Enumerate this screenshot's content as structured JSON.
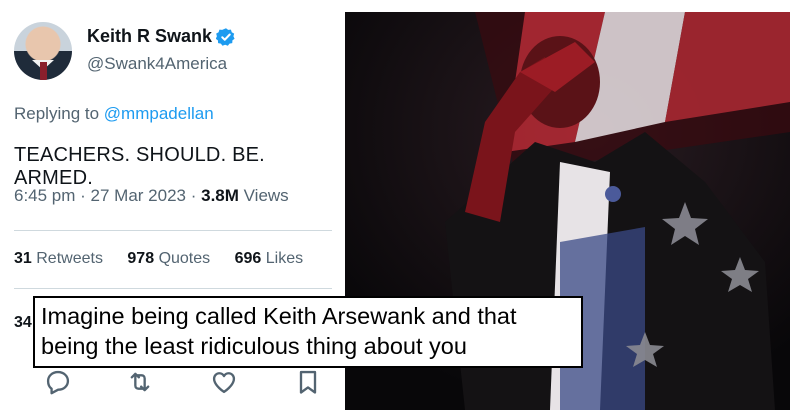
{
  "tweet": {
    "author_name": "Keith R Swank",
    "handle": "@Swank4America",
    "replying_prefix": "Replying to",
    "replying_to": "@mmpadellan",
    "text": "TEACHERS. SHOULD. BE. ARMED.",
    "time_date": "6:45 pm · 27 Mar 2023 ·",
    "views_count": "3.8M",
    "views_label": "Views",
    "retweets_count": "31",
    "retweets_label": "Retweets",
    "quotes_count": "978",
    "quotes_label": "Quotes",
    "likes_count": "696",
    "likes_label": "Likes",
    "partial_count": "34"
  },
  "icons": {
    "verified": "verified-badge-icon",
    "reply": "reply-icon",
    "retweet": "retweet-icon",
    "like": "heart-icon",
    "bookmark": "bookmark-icon"
  },
  "caption": {
    "text": "Imagine being called Keith Arsewank and that being the least ridiculous thing about you"
  },
  "colors": {
    "link": "#1d9bf0",
    "secondary_text": "#536471",
    "primary_text": "#0f1419",
    "flag_red": "#a3242c"
  }
}
